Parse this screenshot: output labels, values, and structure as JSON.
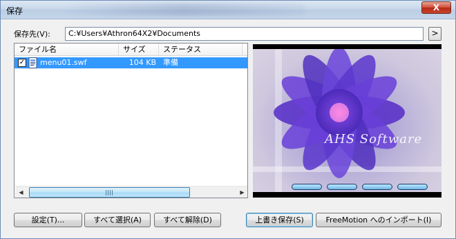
{
  "window": {
    "title": "保存",
    "close_label": "X"
  },
  "path": {
    "label": "保存先(V):",
    "value": "C:¥Users¥Athron64X2¥Documents",
    "browse_label": ">"
  },
  "list": {
    "columns": [
      "ファイル名",
      "サイズ",
      "ステータス"
    ],
    "rows": [
      {
        "checked": true,
        "name": "menu01.swf",
        "size": "104 KB",
        "status": "準備"
      }
    ]
  },
  "preview": {
    "brand_text": "AHS Software"
  },
  "buttons": {
    "settings": "設定(T)...",
    "select_all": "すべて選択(A)",
    "deselect_all": "すべて解除(D)",
    "overwrite_save": "上書き保存(S)",
    "import": "FreeMotion へのインポート(I)"
  },
  "colors": {
    "selection": "#3399ff",
    "accent": "#3c7fb1"
  }
}
